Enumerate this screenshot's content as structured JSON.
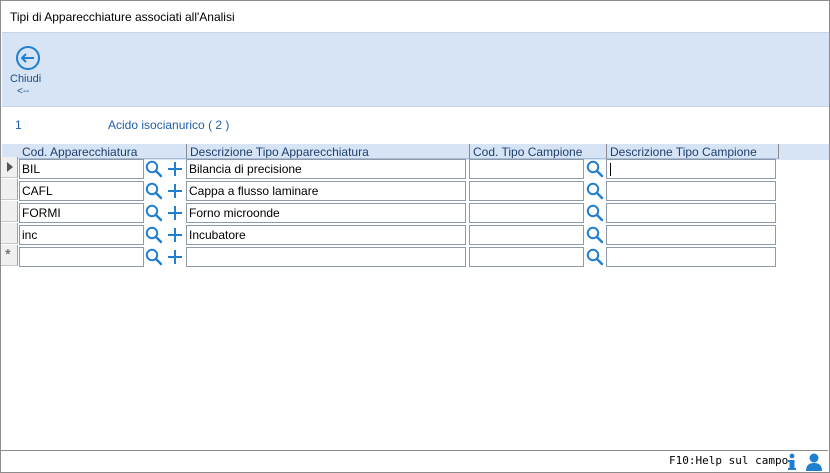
{
  "window": {
    "title": "Tipi di Apparecchiature associati all'Analisi"
  },
  "toolbar": {
    "close_label": "Chiudi",
    "close_shortcut": "<--",
    "close_icon": "arrow-left-circle-icon"
  },
  "analysis": {
    "code": "1",
    "description": "Acido isocianurico",
    "version": "( 2 )"
  },
  "grid": {
    "columns": [
      "Cod. Apparecchiatura",
      "Descrizione Tipo Apparecchiatura",
      "Cod. Tipo Campione",
      "Descrizione Tipo Campione"
    ],
    "rows": [
      {
        "code": "BIL",
        "description": "Bilancia di precisione",
        "sample_code": "",
        "sample_description": ""
      },
      {
        "code": "CAFL",
        "description": "Cappa a flusso laminare",
        "sample_code": "",
        "sample_description": ""
      },
      {
        "code": "FORMI",
        "description": "Forno microonde",
        "sample_code": "",
        "sample_description": ""
      },
      {
        "code": "inc",
        "description": "Incubatore",
        "sample_code": "",
        "sample_description": ""
      },
      {
        "code": "",
        "description": "",
        "sample_code": "",
        "sample_description": ""
      }
    ],
    "new_row_marker": "*"
  },
  "status": {
    "help_text": "F10:Help sul campo"
  },
  "colors": {
    "toolbar_bg": "#d6e4f5",
    "accent": "#1f7fd0",
    "link_text": "#1f5fa8"
  }
}
